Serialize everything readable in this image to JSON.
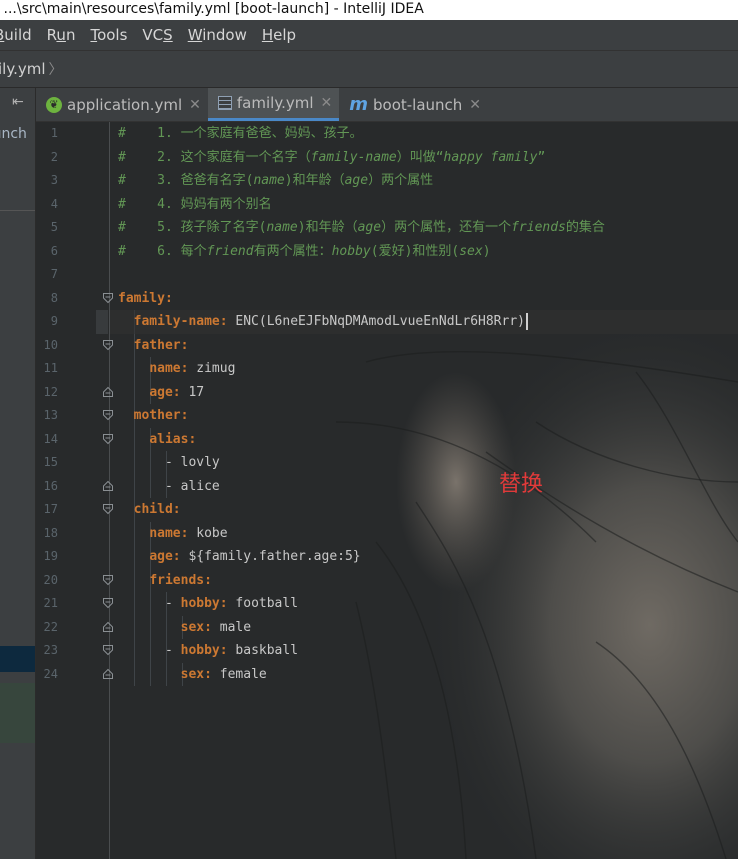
{
  "window": {
    "title": "- ...\\src\\main\\resources\\family.yml [boot-launch] - IntelliJ IDEA"
  },
  "menu": [
    {
      "label": "Build",
      "mnemonic": "B"
    },
    {
      "label": "Run",
      "mnemonic": "u"
    },
    {
      "label": "Tools",
      "mnemonic": "T"
    },
    {
      "label": "VCS",
      "mnemonic": "S"
    },
    {
      "label": "Window",
      "mnemonic": "W"
    },
    {
      "label": "Help",
      "mnemonic": "H"
    }
  ],
  "breadcrumb": {
    "file": "ily.yml"
  },
  "project_panel": {
    "label": "aunch"
  },
  "tabs": [
    {
      "label": "application.yml",
      "icon": "spring-leaf-icon",
      "active": false
    },
    {
      "label": "family.yml",
      "icon": "yml-file-icon",
      "active": true
    },
    {
      "label": "boot-launch",
      "icon": "maven-module-icon",
      "active": false
    }
  ],
  "editor": {
    "annotation": "替换",
    "lines": [
      {
        "n": "1",
        "parts": [
          [
            "c",
            "#    1. 一个家庭有爸爸、妈妈、孩子。"
          ]
        ]
      },
      {
        "n": "2",
        "parts": [
          [
            "c",
            "#    2. 这个家庭有一个名字（"
          ],
          [
            "ci",
            "family-name"
          ],
          [
            "c",
            "）叫做“"
          ],
          [
            "ci",
            "happy family"
          ],
          [
            "c",
            "”"
          ]
        ]
      },
      {
        "n": "3",
        "parts": [
          [
            "c",
            "#    3. 爸爸有名字("
          ],
          [
            "ci",
            "name"
          ],
          [
            "c",
            ")和年龄（"
          ],
          [
            "ci",
            "age"
          ],
          [
            "c",
            "）两个属性"
          ]
        ]
      },
      {
        "n": "4",
        "parts": [
          [
            "c",
            "#    4. 妈妈有两个别名"
          ]
        ]
      },
      {
        "n": "5",
        "parts": [
          [
            "c",
            "#    5. 孩子除了名字("
          ],
          [
            "ci",
            "name"
          ],
          [
            "c",
            ")和年龄（"
          ],
          [
            "ci",
            "age"
          ],
          [
            "c",
            "）两个属性，还有一个"
          ],
          [
            "ci",
            "friends"
          ],
          [
            "c",
            "的集合"
          ]
        ]
      },
      {
        "n": "6",
        "parts": [
          [
            "c",
            "#    6. 每个"
          ],
          [
            "ci",
            "friend"
          ],
          [
            "c",
            "有两个属性："
          ],
          [
            "ci",
            "hobby"
          ],
          [
            "c",
            "(爱好)和性别("
          ],
          [
            "ci",
            "sex"
          ],
          [
            "c",
            ")"
          ]
        ]
      },
      {
        "n": "7",
        "parts": []
      },
      {
        "n": "8",
        "parts": [
          [
            "k",
            "family:"
          ]
        ]
      },
      {
        "n": "9",
        "parts": [
          [
            "v",
            "  "
          ],
          [
            "k",
            "family-name:"
          ],
          [
            "v",
            " ENC(L6neEJFbNqDMAmodLvueEnNdLr6H8Rrr)"
          ]
        ]
      },
      {
        "n": "10",
        "parts": [
          [
            "v",
            "  "
          ],
          [
            "k",
            "father:"
          ]
        ]
      },
      {
        "n": "11",
        "parts": [
          [
            "v",
            "    "
          ],
          [
            "k",
            "name:"
          ],
          [
            "v",
            " zimug"
          ]
        ]
      },
      {
        "n": "12",
        "parts": [
          [
            "v",
            "    "
          ],
          [
            "k",
            "age:"
          ],
          [
            "v",
            " 17"
          ]
        ]
      },
      {
        "n": "13",
        "parts": [
          [
            "v",
            "  "
          ],
          [
            "k",
            "mother:"
          ]
        ]
      },
      {
        "n": "14",
        "parts": [
          [
            "v",
            "    "
          ],
          [
            "k",
            "alias:"
          ]
        ]
      },
      {
        "n": "15",
        "parts": [
          [
            "v",
            "      - lovly"
          ]
        ]
      },
      {
        "n": "16",
        "parts": [
          [
            "v",
            "      - alice"
          ]
        ]
      },
      {
        "n": "17",
        "parts": [
          [
            "v",
            "  "
          ],
          [
            "k",
            "child:"
          ]
        ]
      },
      {
        "n": "18",
        "parts": [
          [
            "v",
            "    "
          ],
          [
            "k",
            "name:"
          ],
          [
            "v",
            " kobe"
          ]
        ]
      },
      {
        "n": "19",
        "parts": [
          [
            "v",
            "    "
          ],
          [
            "k",
            "age:"
          ],
          [
            "v",
            " ${family.father.age:5}"
          ]
        ]
      },
      {
        "n": "20",
        "parts": [
          [
            "v",
            "    "
          ],
          [
            "k",
            "friends:"
          ]
        ]
      },
      {
        "n": "21",
        "parts": [
          [
            "v",
            "      - "
          ],
          [
            "k",
            "hobby:"
          ],
          [
            "v",
            " football"
          ]
        ]
      },
      {
        "n": "22",
        "parts": [
          [
            "v",
            "        "
          ],
          [
            "k",
            "sex:"
          ],
          [
            "v",
            " male"
          ]
        ]
      },
      {
        "n": "23",
        "parts": [
          [
            "v",
            "      - "
          ],
          [
            "k",
            "hobby:"
          ],
          [
            "v",
            " baskball"
          ]
        ]
      },
      {
        "n": "24",
        "parts": [
          [
            "v",
            "        "
          ],
          [
            "k",
            "sex:"
          ],
          [
            "v",
            " female"
          ]
        ]
      }
    ],
    "fold_lines": {
      "open": [
        "8",
        "10",
        "13",
        "14",
        "17",
        "20",
        "21",
        "23"
      ],
      "close": [
        "12",
        "16",
        "22",
        "24"
      ]
    },
    "caret_line": "9"
  },
  "colors": {
    "comment": "#629755",
    "key": "#cc7832",
    "annotation": "#e03a3a",
    "active_tab_underline": "#4a88c7"
  }
}
